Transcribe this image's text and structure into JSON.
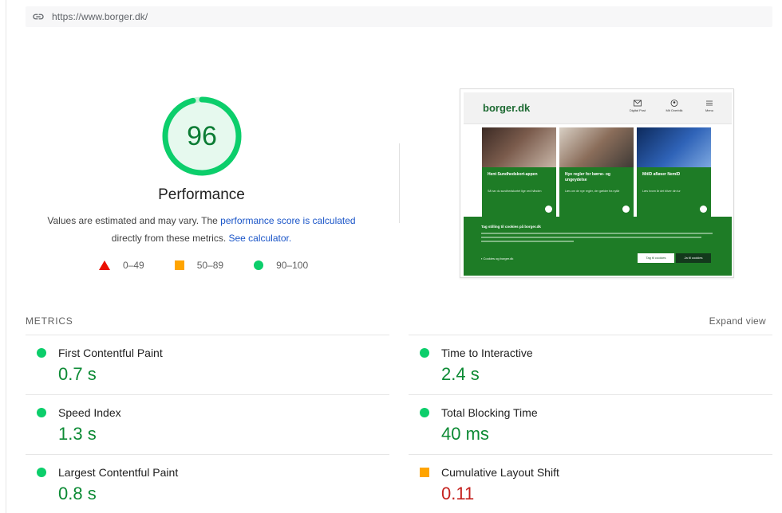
{
  "url": "https://www.borger.dk/",
  "score": "96",
  "score_fraction": 0.96,
  "colors": {
    "good": "#0cce6b",
    "average": "#ffa400",
    "poor": "#eb0f00",
    "link": "#1a55c8"
  },
  "performance": {
    "title": "Performance",
    "desc_prefix": "Values are estimated and may vary. The ",
    "desc_link": "performance score is calculated",
    "desc_middle": " directly from these metrics. ",
    "desc_link2": "See calculator."
  },
  "legend": [
    {
      "shape": "triangle-icon",
      "range": "0–49"
    },
    {
      "shape": "square-icon",
      "range": "50–89"
    },
    {
      "shape": "circle-icon",
      "range": "90–100"
    }
  ],
  "thumbnail": {
    "logo": "borger.dk",
    "nav": [
      "Digital Post",
      "Mit Overblik",
      "Menu"
    ],
    "cards": [
      {
        "title": "Hent Sundhedskort-appen",
        "text": "Så har du sundhedskortet lige ved hånden"
      },
      {
        "title": "Nye regler for børne- og ungeydelse",
        "text": "Læs om de nye regler, der gælder fra nytår"
      },
      {
        "title": "MitID afløser NemID",
        "text": "Læs hvorn år det bliver din tur"
      }
    ],
    "cookie_title": "Tag stilling til cookies på borger.dk",
    "cookie_check": "Cookies og borger.dk",
    "cookie_btn1": "Tag til cookies",
    "cookie_btn2": "Ja til cookies"
  },
  "metrics": {
    "title": "METRICS",
    "expand": "Expand view",
    "left": [
      {
        "label": "First Contentful Paint",
        "value": "0.7 s",
        "status": "good"
      },
      {
        "label": "Speed Index",
        "value": "1.3 s",
        "status": "good"
      },
      {
        "label": "Largest Contentful Paint",
        "value": "0.8 s",
        "status": "good"
      }
    ],
    "right": [
      {
        "label": "Time to Interactive",
        "value": "2.4 s",
        "status": "good"
      },
      {
        "label": "Total Blocking Time",
        "value": "40 ms",
        "status": "good"
      },
      {
        "label": "Cumulative Layout Shift",
        "value": "0.11",
        "status": "average"
      }
    ]
  }
}
